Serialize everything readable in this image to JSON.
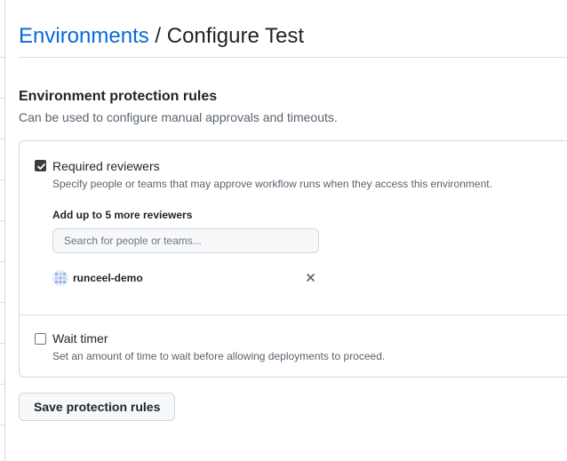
{
  "breadcrumb": {
    "parent": "Environments",
    "separator": "/",
    "current": "Configure Test"
  },
  "section": {
    "title": "Environment protection rules",
    "description": "Can be used to configure manual approvals and timeouts."
  },
  "rules": {
    "required_reviewers": {
      "checked": true,
      "label": "Required reviewers",
      "description": "Specify people or teams that may approve workflow runs when they access this environment.",
      "add_label": "Add up to 5 more reviewers",
      "search_placeholder": "Search for people or teams...",
      "reviewers": [
        {
          "name": "runceel-demo",
          "icon": "identicon-avatar"
        }
      ]
    },
    "wait_timer": {
      "checked": false,
      "label": "Wait timer",
      "description": "Set an amount of time to wait before allowing deployments to proceed."
    }
  },
  "actions": {
    "save_label": "Save protection rules"
  },
  "colors": {
    "link": "#0969da",
    "text": "#1f2328",
    "muted": "#59636e",
    "border": "#d0d7de",
    "button_bg": "#f6f8fa",
    "checkbox_checked": "#3c3c3c"
  }
}
